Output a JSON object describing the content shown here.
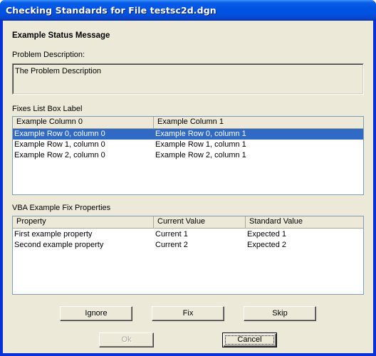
{
  "window": {
    "title": "Checking Standards for File testsc2d.dgn"
  },
  "status_message": "Example Status Message",
  "problem": {
    "label": "Problem Description:",
    "text": "The Problem Description"
  },
  "fixes": {
    "label": "Fixes List Box Label",
    "columns": [
      "Example Column 0",
      "Example Column 1"
    ],
    "rows": [
      [
        "Example Row 0, column 0",
        "Example Row 0, column 1"
      ],
      [
        "Example Row 1, column 0",
        "Example Row 1, column 1"
      ],
      [
        "Example Row 2, column 0",
        "Example Row 2, column 1"
      ]
    ],
    "selected_row": 0
  },
  "properties": {
    "label": "VBA Example Fix Properties",
    "columns": [
      "Property",
      "Current Value",
      "Standard Value"
    ],
    "rows": [
      [
        "First example property",
        "Current 1",
        "Expected 1"
      ],
      [
        "Second example property",
        "Current 2",
        "Expected 2"
      ]
    ]
  },
  "buttons": {
    "ignore": "Ignore",
    "fix": "Fix",
    "skip": "Skip",
    "ok": "Ok",
    "cancel": "Cancel"
  },
  "colors": {
    "titlebar": "#0054e3",
    "dialog_bg": "#ece9d8",
    "selection": "#316ac5"
  }
}
